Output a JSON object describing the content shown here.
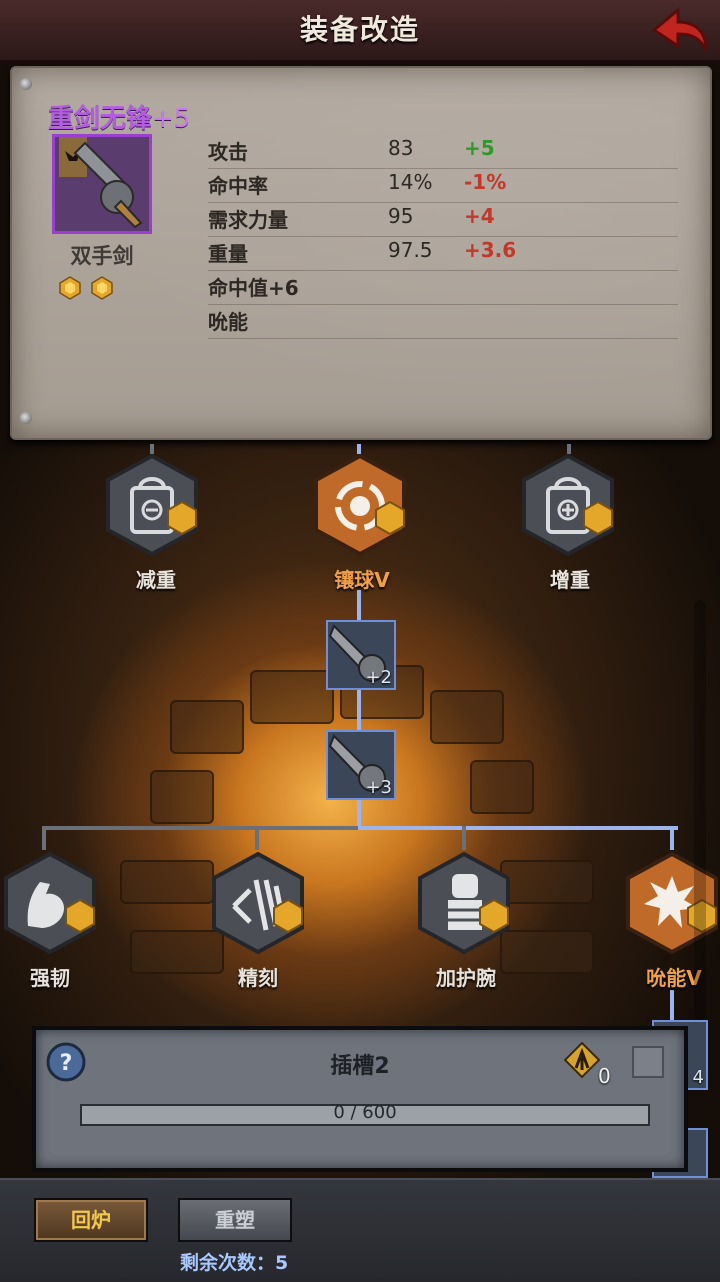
{
  "header": {
    "title": "装备改造"
  },
  "item": {
    "name": "重剑无锋",
    "plus": "+5",
    "type": "双手剑",
    "stats": [
      {
        "name": "攻击",
        "value": "83",
        "delta": "+5",
        "sign": "pos"
      },
      {
        "name": "命中率",
        "value": "14%",
        "delta": "-1%",
        "sign": "neg"
      },
      {
        "name": "需求力量",
        "value": "95",
        "delta": "+4",
        "sign": "neg"
      },
      {
        "name": "重量",
        "value": "97.5",
        "delta": "+3.6",
        "sign": "neg"
      },
      {
        "name": "命中值+6",
        "value": "",
        "delta": "",
        "sign": ""
      },
      {
        "name": "吮能",
        "value": "",
        "delta": "",
        "sign": ""
      }
    ]
  },
  "tree": {
    "row1": [
      "减重",
      "镶球V",
      "增重"
    ],
    "upgrades": [
      "+2",
      "+3"
    ],
    "row2": [
      "强韧",
      "精刻",
      "加护腕",
      "吮能V"
    ],
    "partial_level": "4"
  },
  "slot": {
    "title": "插槽2",
    "help": "?",
    "token_count": "0",
    "progress_text": "0 / 600",
    "progress": 0
  },
  "footer": {
    "forge_label": "回炉",
    "reshape_label": "重塑",
    "remaining": "剩余次数：5"
  }
}
